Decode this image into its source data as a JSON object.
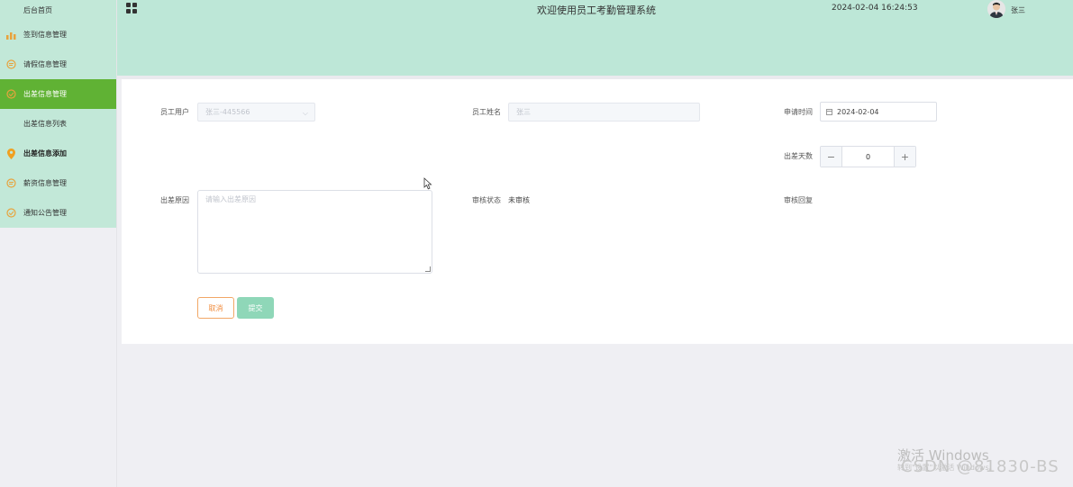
{
  "sidebar": {
    "items": [
      {
        "label": "后台首页",
        "icon": "home-icon"
      },
      {
        "label": "签到信息管理",
        "icon": "bar-chart-icon",
        "icon_color": "#e8a33d"
      },
      {
        "label": "请假信息管理",
        "icon": "chat-bubble-icon",
        "icon_color": "#e8a33d"
      },
      {
        "label": "出差信息管理",
        "icon": "check-circle-icon",
        "icon_color": "#e8a33d"
      },
      {
        "label": "出差信息列表"
      },
      {
        "label": "出差信息添加",
        "icon": "location-pin-icon",
        "icon_color": "#f0a020"
      },
      {
        "label": "薪资信息管理",
        "icon": "chat-bubble-icon",
        "icon_color": "#e8a33d"
      },
      {
        "label": "通知公告管理",
        "icon": "check-circle-icon",
        "icon_color": "#e8a33d"
      }
    ],
    "active_color": "#60b234",
    "bg_color": "#c2e8d8"
  },
  "header": {
    "title": "欢迎使用员工考勤管理系统",
    "datetime": "2024-02-04 16:24:53",
    "username": "张三",
    "bg_color": "#bde7d7"
  },
  "form": {
    "employee_user": {
      "label": "员工用户",
      "value": "张三-445566"
    },
    "employee_name": {
      "label": "员工姓名",
      "value": "张三"
    },
    "apply_time": {
      "label": "申请时间",
      "value": "2024-02-04"
    },
    "trip_days": {
      "label": "出差天数",
      "value": "0",
      "minus": "−",
      "plus": "+"
    },
    "trip_reason": {
      "label": "出差原因",
      "placeholder": "请输入出差原因"
    },
    "audit_status": {
      "label": "审核状态",
      "value": "未审核"
    },
    "audit_reply": {
      "label": "审核回复"
    },
    "cancel_label": "取消",
    "submit_label": "提交",
    "cancel_color": "#f08a3a",
    "submit_color": "#8fd7b8"
  },
  "watermark": {
    "line1": "激活 Windows",
    "line2": "转到\"设置\"以激活 Windows。",
    "csdn": "CSDN @81830-BS"
  }
}
